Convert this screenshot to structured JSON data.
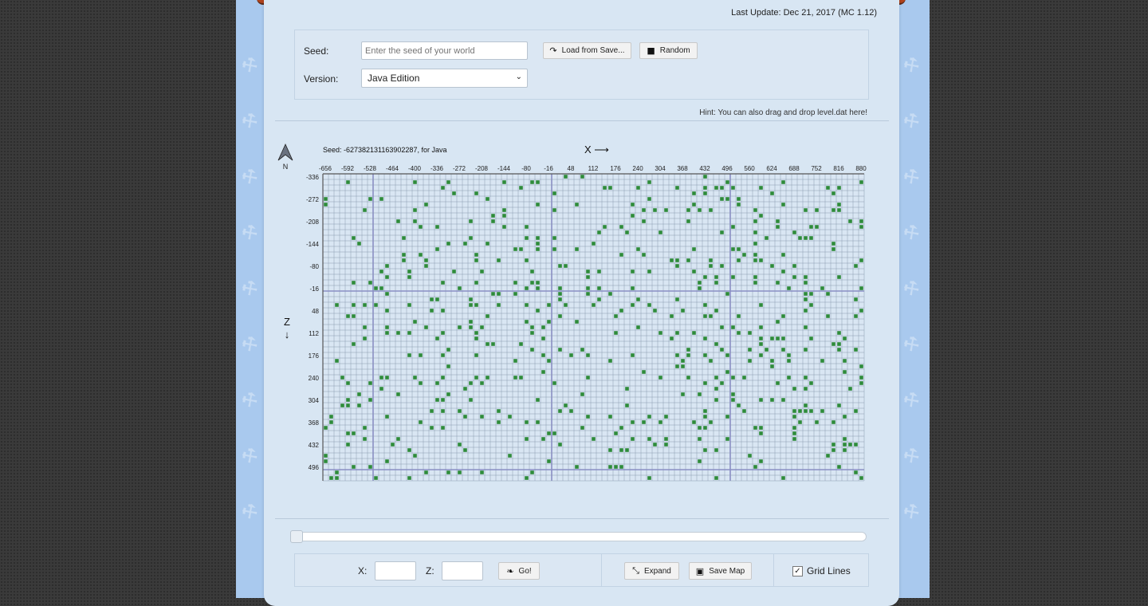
{
  "header": {
    "last_update": "Last Update: Dec 21, 2017 (MC 1.12)"
  },
  "form": {
    "seed_label": "Seed:",
    "seed_placeholder": "Enter the seed of your world",
    "version_label": "Version:",
    "version_value": "Java Edition",
    "load_button": "Load from Save...",
    "random_button": "Random",
    "hint": "Hint: You can also drag and drop level.dat here!"
  },
  "map": {
    "seed_info": "Seed: -627382131163902287, for Java",
    "north_label": "N",
    "x_axis_label": "X",
    "z_axis_label": "Z",
    "x_ticks": [
      "-656",
      "-592",
      "-528",
      "-464",
      "-400",
      "-336",
      "-272",
      "-208",
      "-144",
      "-80",
      "-16",
      "48",
      "112",
      "176",
      "240",
      "304",
      "368",
      "432",
      "496",
      "560",
      "624",
      "688",
      "752",
      "816",
      "880"
    ],
    "z_ticks": [
      "-336",
      "-272",
      "-208",
      "-144",
      "-80",
      "-16",
      "48",
      "112",
      "176",
      "240",
      "304",
      "368",
      "432",
      "496"
    ],
    "colors": {
      "background": "#d9e6f3",
      "grid": "#8a9bb0",
      "major_grid": "#8a8fc4",
      "slime_chunk": "#2e8b3a"
    }
  },
  "controls": {
    "x_label": "X:",
    "z_label": "Z:",
    "go_button": "Go!",
    "expand_button": "Expand",
    "save_map_button": "Save Map",
    "grid_lines_label": "Grid Lines",
    "grid_lines_checked": true,
    "zoom_fraction": 0.0
  }
}
